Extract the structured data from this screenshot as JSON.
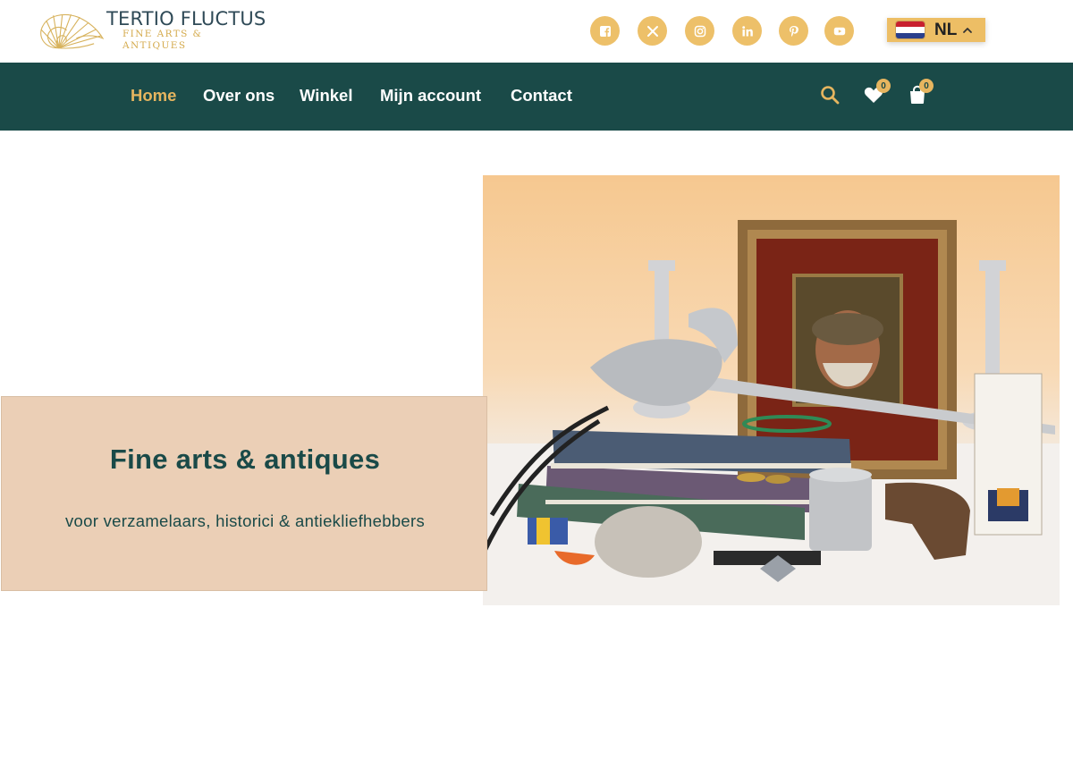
{
  "brand": {
    "title": "TERTIO FLUCTUS",
    "subtitle": "FINE ARTS & ANTIQUES",
    "logo_icon": "nautilus-shell-icon"
  },
  "social": [
    {
      "name": "facebook",
      "icon": "facebook-icon"
    },
    {
      "name": "x",
      "icon": "x-icon"
    },
    {
      "name": "instagram",
      "icon": "instagram-icon"
    },
    {
      "name": "linkedin",
      "icon": "linkedin-icon"
    },
    {
      "name": "pinterest",
      "icon": "pinterest-icon"
    },
    {
      "name": "youtube",
      "icon": "youtube-icon"
    }
  ],
  "language": {
    "code": "NL",
    "flag": "netherlands-flag-icon"
  },
  "nav": {
    "items": [
      {
        "label": "Home",
        "active": true
      },
      {
        "label": "Over ons",
        "active": false
      },
      {
        "label": "Winkel",
        "active": false
      },
      {
        "label": "Mijn account",
        "active": false
      },
      {
        "label": "Contact",
        "active": false
      }
    ],
    "wishlist_count": "0",
    "cart_count": "0"
  },
  "hero": {
    "title": "Fine arts & antiques",
    "subtitle": "voor verzamelaars, historici & antiekliefhebbers"
  },
  "colors": {
    "nav_bg": "#1a4a48",
    "accent": "#e6b55f",
    "hero_box": "#ebcfb6"
  }
}
